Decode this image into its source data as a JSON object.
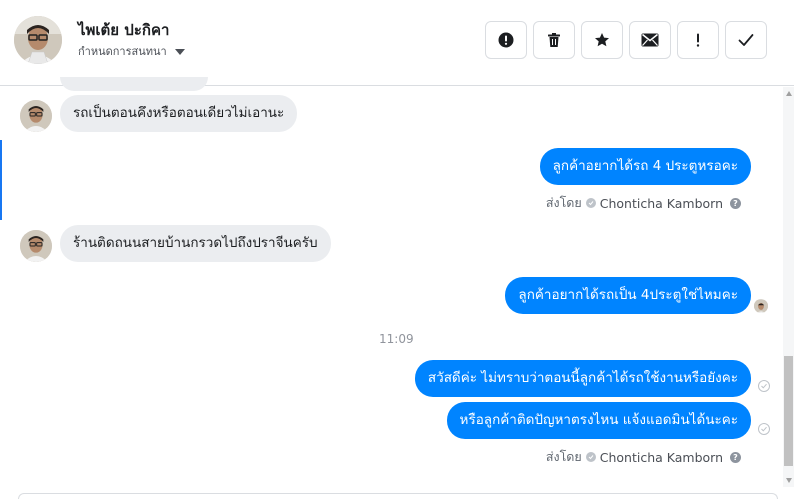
{
  "header": {
    "contact_name": "ไพเต้ย ปะกิคา",
    "contact_sub": "กำหนดการสนทนา",
    "toolbar": [
      {
        "name": "mark-spam-button",
        "icon": "alert-circle-icon"
      },
      {
        "name": "delete-button",
        "icon": "trash-icon"
      },
      {
        "name": "star-button",
        "icon": "star-icon"
      },
      {
        "name": "mark-unread-button",
        "icon": "envelope-icon"
      },
      {
        "name": "important-button",
        "icon": "exclamation-icon"
      },
      {
        "name": "done-button",
        "icon": "check-icon"
      }
    ]
  },
  "messages": [
    {
      "direction": "in",
      "text": "รถเป็นตอนคึงหรือตอนเดียวไม่เอานะ"
    },
    {
      "direction": "out",
      "text": "ลูกค้าอยากได้รถ 4 ประตูหรอคะ"
    },
    {
      "direction": "in",
      "text": "ร้านติดถนนสายบ้านกรวดไปถึงปราจีนครับ"
    },
    {
      "direction": "out",
      "text": "ลูกค้าอยากได้รถเป็น 4ประตูใช่ไหมคะ"
    },
    {
      "direction": "out",
      "text": "สวัสดีค่ะ ไม่ทราบว่าตอนนี้ลูกค้าได้รถใช้งานหรือยังคะ"
    },
    {
      "direction": "out",
      "text": "หรือลูกค้าติดปัญหาตรงไหน แจ้งแอดมินได้นะคะ"
    }
  ],
  "sent_by": {
    "prefix": "ส่งโดย",
    "name": "Chonticha Kamborn"
  },
  "timestamp": "11:09",
  "colors": {
    "outgoing_bubble": "#0084ff",
    "incoming_bubble": "#ebedf0",
    "accent": "#1877f2"
  }
}
